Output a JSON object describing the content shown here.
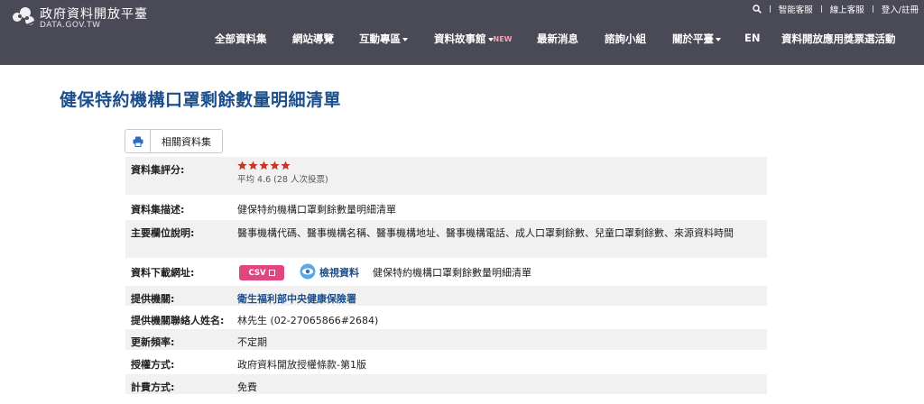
{
  "header": {
    "site_title": "政府資料開放平臺",
    "site_domain": "DATA.GOV.TW",
    "topbar": {
      "search_icon": "search-icon",
      "links": [
        "智能客服",
        "線上客服",
        "登入/註冊"
      ]
    },
    "nav": [
      {
        "label": "全部資料集"
      },
      {
        "label": "網站導覽"
      },
      {
        "label": "互動專區",
        "dropdown": true
      },
      {
        "label": "資料故事館",
        "dropdown": true,
        "badge": "NEW"
      },
      {
        "label": "最新消息"
      },
      {
        "label": "諮詢小組"
      },
      {
        "label": "關於平臺",
        "dropdown": true
      },
      {
        "label": "EN"
      },
      {
        "label": "資料開放應用獎票選活動"
      }
    ]
  },
  "page": {
    "title": "健保特約機構口罩剩餘數量明細清單",
    "toolbar": {
      "print_icon": "print-icon",
      "related_label": "相關資料集"
    },
    "details": {
      "rating": {
        "label": "資料集評分:",
        "stars": 5,
        "summary": "平均 4.6 (28 人次投票)"
      },
      "description": {
        "label": "資料集描述:",
        "value": "健保特約機構口罩剩餘數量明細清單"
      },
      "fields": {
        "label": "主要欄位說明:",
        "value": "醫事機構代碼、醫事機構名稱、醫事機構地址、醫事機構電話、成人口罩剩餘數、兒童口罩剩餘數、來源資料時間"
      },
      "download": {
        "label": "資料下載網址:",
        "format": "CSV",
        "view_label": "檢視資料",
        "resource_name": "健保特約機構口罩剩餘數量明細清單"
      },
      "provider": {
        "label": "提供機關:",
        "value": "衛生福利部中央健康保險署"
      },
      "contact": {
        "label": "提供機關聯絡人姓名:",
        "value": "林先生 (02-27065866#2684)"
      },
      "frequency": {
        "label": "更新頻率:",
        "value": "不定期"
      },
      "license": {
        "label": "授權方式:",
        "value": "政府資料開放授權條款-第1版"
      },
      "fee": {
        "label": "計費方式:",
        "value": "免費"
      }
    }
  },
  "colors": {
    "header_bg": "#4a4a57",
    "title_blue": "#1b4e8c",
    "csv_pink": "#e0467f",
    "star_red": "#c0392b",
    "row_shade": "#f1f1f1"
  }
}
